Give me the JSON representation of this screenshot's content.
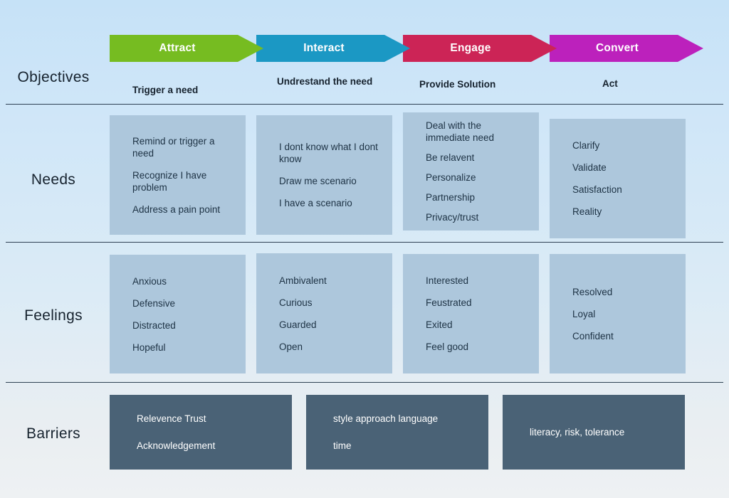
{
  "stages": [
    {
      "label": "Attract",
      "color": "#76bc21"
    },
    {
      "label": "Interact",
      "color": "#1b98c4"
    },
    {
      "label": "Engage",
      "color": "#cc2456"
    },
    {
      "label": "Convert",
      "color": "#bc21bc"
    }
  ],
  "row_labels": {
    "objectives": "Objectives",
    "needs": "Needs",
    "feelings": "Feelings",
    "barriers": "Barriers"
  },
  "objectives": [
    "Trigger a need",
    "Undrestand the need",
    "Provide Solution",
    "Act"
  ],
  "needs": [
    [
      "Remind or trigger a need",
      "Recognize I have problem",
      "Address a pain point"
    ],
    [
      "I dont know what I dont know",
      "Draw me scenario",
      "I have a scenario"
    ],
    [
      "Deal with the immediate need",
      "Be relavent",
      "Personalize",
      "Partnership",
      "Privacy/trust"
    ],
    [
      "Clarify",
      "Validate",
      "Satisfaction",
      "Reality"
    ]
  ],
  "feelings": [
    [
      "Anxious",
      "Defensive",
      "Distracted",
      "Hopeful"
    ],
    [
      "Ambivalent",
      "Curious",
      "Guarded",
      "Open"
    ],
    [
      "Interested",
      "Feustrated",
      "Exited",
      "Feel good"
    ],
    [
      "Resolved",
      "Loyal",
      "Confident"
    ]
  ],
  "barriers": [
    [
      "Relevence Trust",
      "Acknowledgement"
    ],
    [
      "style approach language",
      "time"
    ],
    [
      "literacy, risk, tolerance"
    ]
  ],
  "colors": {
    "background_top": "#c6e2f7",
    "background_bottom": "#eef1f3",
    "card_fill": "#adc7dc",
    "barrier_fill": "#4a6276",
    "divider": "#2f4154",
    "text_dark": "#16222e",
    "text_light": "#ffffff"
  }
}
